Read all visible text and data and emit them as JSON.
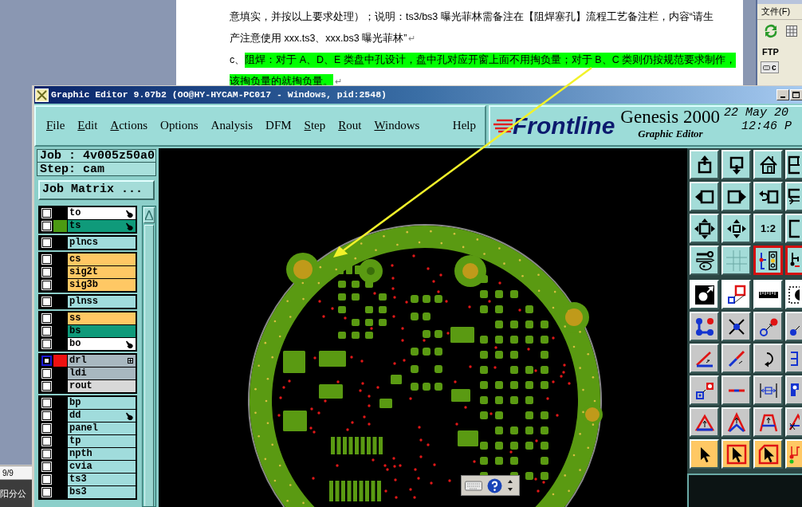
{
  "document": {
    "lines": [
      {
        "segments": [
          {
            "text": "意填实，并按以上要求处理）；说明：ts3/bs3 曝光菲林需备注在【阻焊塞孔】流程工艺备注栏，内容“请生",
            "highlighted": false
          }
        ]
      },
      {
        "segments": [
          {
            "text": "产注意使用 xxx.ts3、xxx.bs3 曝光菲林”",
            "highlighted": false
          }
        ],
        "mark": "↵"
      },
      {
        "segments": [
          {
            "text": "c、",
            "highlighted": false
          },
          {
            "text": "阻焊：对于 A、D、E 类盘中孔设计，盘中孔对应开窗上面不用掏负量；对于 B、C 类则仍按规范要求制作，",
            "highlighted": true
          }
        ]
      },
      {
        "segments": [
          {
            "text": "该掏负量的就掏负量。",
            "highlighted": true
          }
        ],
        "mark": "↵"
      }
    ]
  },
  "side_window": {
    "menu": "文件(F)",
    "label": "FTP",
    "button": "c"
  },
  "taskbar_window": {
    "page": "9/9",
    "title": "阳分公"
  },
  "window": {
    "title": "Graphic Editor 9.07b2 (OO@HY-HYCAM-PC017 - Windows, pid:2548)"
  },
  "menu": [
    {
      "label": "File",
      "mnemonic": true
    },
    {
      "label": "Edit",
      "mnemonic": true
    },
    {
      "label": "Actions",
      "mnemonic": true
    },
    {
      "label": "Options",
      "mnemonic": false
    },
    {
      "label": "Analysis",
      "mnemonic": false
    },
    {
      "label": "DFM",
      "mnemonic": false
    },
    {
      "label": "Step",
      "mnemonic": true
    },
    {
      "label": "Rout",
      "mnemonic": true
    },
    {
      "label": "Windows",
      "mnemonic": true
    },
    {
      "label": "Help",
      "mnemonic": false
    }
  ],
  "brand": {
    "logo": "Frontline",
    "product": "Genesis 2000",
    "subtitle": "Graphic Editor",
    "date": "22 May 20",
    "time": "12:46 P"
  },
  "job": {
    "job": "Job : 4v005z50a0",
    "step": "Step: cam",
    "matrix_button": "Job Matrix ..."
  },
  "layer_groups": [
    {
      "layers": [
        {
          "name": "to",
          "color": "#ffffff",
          "focused": false,
          "hand_mark": true,
          "box_mark": false
        },
        {
          "name": "ts",
          "color": "#0f9a7a",
          "swatch": {
            "color": "#4c9a12"
          },
          "focused": false,
          "hand_mark": true,
          "box_mark": false
        }
      ]
    },
    {
      "layers": [
        {
          "name": "plncs",
          "color": "#a0dcdc",
          "focused": false,
          "hand_mark": false,
          "box_mark": false
        }
      ]
    },
    {
      "layers": [
        {
          "name": "cs",
          "color": "#ffc864",
          "focused": false,
          "hand_mark": false,
          "box_mark": false
        },
        {
          "name": "sig2t",
          "color": "#ffc864",
          "focused": false,
          "hand_mark": false,
          "box_mark": false
        },
        {
          "name": "sig3b",
          "color": "#ffc864",
          "focused": false,
          "hand_mark": false,
          "box_mark": false
        }
      ]
    },
    {
      "layers": [
        {
          "name": "plnss",
          "color": "#a0dcdc",
          "focused": false,
          "hand_mark": false,
          "box_mark": false
        }
      ]
    },
    {
      "layers": [
        {
          "name": "ss",
          "color": "#ffc864",
          "focused": false,
          "hand_mark": false,
          "box_mark": false
        },
        {
          "name": "bs",
          "color": "#0f9a7a",
          "focused": false,
          "hand_mark": false,
          "box_mark": false
        },
        {
          "name": "bo",
          "color": "#ffffff",
          "focused": false,
          "hand_mark": true,
          "box_mark": false
        }
      ]
    },
    {
      "layers": [
        {
          "name": "drl",
          "color": "#a8b8c0",
          "swatch": {
            "color": "#ee1111"
          },
          "focused": true,
          "hand_mark": false,
          "box_mark": true
        },
        {
          "name": "ldi",
          "color": "#a8b8c0",
          "focused": false,
          "hand_mark": false,
          "box_mark": false
        },
        {
          "name": "rout",
          "color": "#d8d8d8",
          "focused": false,
          "hand_mark": false,
          "box_mark": false
        }
      ]
    },
    {
      "layers": [
        {
          "name": "bp",
          "color": "#a0dcdc",
          "focused": false,
          "hand_mark": false,
          "box_mark": false
        },
        {
          "name": "dd",
          "color": "#a0dcdc",
          "focused": false,
          "hand_mark": true,
          "box_mark": false
        },
        {
          "name": "panel",
          "color": "#a0dcdc",
          "focused": false,
          "hand_mark": false,
          "box_mark": false
        },
        {
          "name": "tp",
          "color": "#a0dcdc",
          "focused": false,
          "hand_mark": false,
          "box_mark": false
        },
        {
          "name": "npth",
          "color": "#a0dcdc",
          "focused": false,
          "hand_mark": false,
          "box_mark": false
        },
        {
          "name": "cvia",
          "color": "#a0dcdc",
          "focused": false,
          "hand_mark": false,
          "box_mark": false
        },
        {
          "name": "ts3",
          "color": "#a0dcdc",
          "focused": false,
          "hand_mark": false,
          "box_mark": false
        },
        {
          "name": "bs3",
          "color": "#a0dcdc",
          "focused": false,
          "hand_mark": false,
          "box_mark": false
        }
      ]
    }
  ],
  "tools": [
    [
      {
        "selected": false
      },
      {
        "selected": false
      },
      {
        "selected": false
      },
      {
        "selected": false
      }
    ],
    [
      {
        "selected": false
      },
      {
        "selected": false
      },
      {
        "selected": false
      },
      {
        "selected": false
      }
    ],
    [
      {
        "selected": false
      },
      {
        "selected": false
      },
      {
        "label": "1:2",
        "selected": false
      },
      {
        "selected": false
      }
    ],
    [
      {
        "selected": false
      },
      {
        "selected": false
      },
      {
        "selected": true
      },
      {
        "selected": true
      }
    ],
    [
      {
        "selected": false
      },
      {
        "selected": false
      },
      {
        "selected": false
      },
      {
        "selected": false
      }
    ],
    [
      {
        "selected": false
      },
      {
        "selected": false
      },
      {
        "selected": false
      },
      {
        "selected": false
      }
    ],
    [
      {
        "selected": false
      },
      {
        "selected": false
      },
      {
        "selected": false
      },
      {
        "selected": false
      }
    ],
    [
      {
        "selected": false
      },
      {
        "selected": false
      },
      {
        "selected": false
      },
      {
        "selected": false
      }
    ],
    [
      {
        "selected": false
      },
      {
        "selected": false
      },
      {
        "selected": false
      },
      {
        "selected": false
      }
    ],
    [
      {
        "selected": false
      },
      {
        "selected": false
      },
      {
        "selected": false
      },
      {
        "selected": false
      }
    ]
  ]
}
